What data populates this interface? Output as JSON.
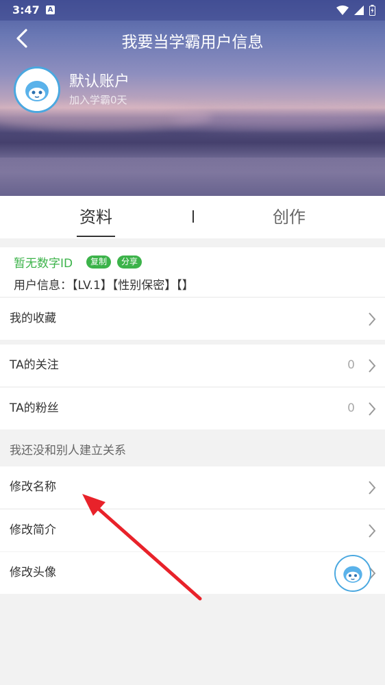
{
  "status_bar": {
    "time": "3:47",
    "notification_icon": "A"
  },
  "header": {
    "title": "我要当学霸用户信息",
    "back_icon": "chevron-left-icon"
  },
  "profile": {
    "name": "默认账户",
    "joined": "加入学霸0天"
  },
  "tabs": [
    {
      "label": "资料",
      "active": true
    },
    {
      "label": "创作",
      "active": false
    }
  ],
  "info": {
    "digital_id": "暂无数字ID",
    "copy_label": "复制",
    "share_label": "分享",
    "user_info": "用户信息：【LV.1】【性别保密】【】"
  },
  "rows": {
    "favorites": {
      "label": "我的收藏"
    },
    "following": {
      "label": "TA的关注",
      "count": "0"
    },
    "fans": {
      "label": "TA的粉丝",
      "count": "0"
    },
    "hint": "我还没和别人建立关系",
    "rename": {
      "label": "修改名称"
    },
    "edit_intro": {
      "label": "修改简介"
    },
    "edit_avatar": {
      "label": "修改头像"
    }
  },
  "colors": {
    "accent_green": "#3cb34a",
    "avatar_border": "#4aa8e0",
    "annotation_arrow": "#e8222a"
  }
}
